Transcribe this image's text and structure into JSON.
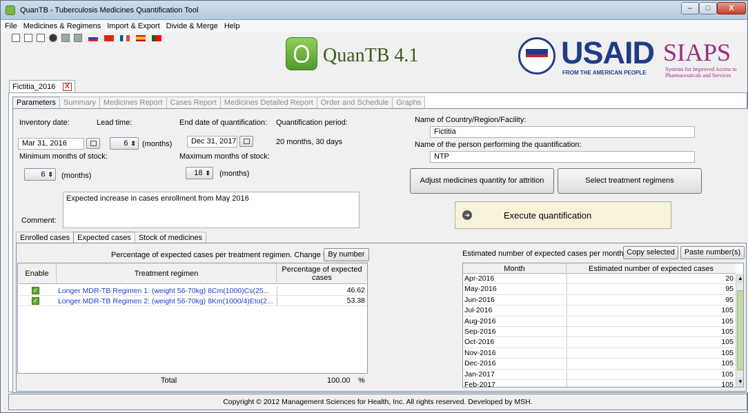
{
  "window": {
    "title": "QuanTB - Tuberculosis Medicines Quantification Tool",
    "min": "–",
    "max": "□",
    "close": "X"
  },
  "menu": [
    "File",
    "Medicines & Regimens",
    "Import & Export",
    "Divide & Merge",
    "Help"
  ],
  "brand": {
    "name": "QuanTB 4.1",
    "usaid": "USAID",
    "usaid_tag": "FROM THE AMERICAN PEOPLE",
    "siaps": "SIAPS",
    "siaps_tag": "Systems for Improved Access to Pharmaceuticals and Services"
  },
  "doc_tab": {
    "label": "Fictitia_2016",
    "close": "X"
  },
  "page_tabs": [
    "Parameters",
    "Summary",
    "Medicines Report",
    "Cases Report",
    "Medicines Detailed Report",
    "Order and Schedule",
    "Graphs"
  ],
  "params": {
    "inventory_label": "Inventory date:",
    "inventory_value": "Mar 31, 2016",
    "lead_label": "Lead time:",
    "lead_value": "6",
    "lead_unit": "(months)",
    "end_label": "End date of quantification:",
    "end_value": "Dec 31, 2017",
    "period_label": "Quantification period:",
    "period_value": "20 months, 30 days",
    "min_label": "Minimum months of stock:",
    "min_value": "6",
    "min_unit": "(months)",
    "max_label": "Maximum months of stock:",
    "max_value": "18",
    "max_unit": "(months)",
    "comment_label": "Comment:",
    "comment_value": "Expected increase in cases enrollment from May 2016",
    "country_label": "Name of Country/Region/Facility:",
    "country_value": "Fictitia",
    "person_label": "Name of the person performing the quantification:",
    "person_value": "NTP",
    "adjust_btn": "Adjust medicines quantity for attrition",
    "select_btn": "Select treatment regimens",
    "execute_btn": "Execute quantification"
  },
  "sub_tabs": [
    "Enrolled cases",
    "Expected cases",
    "Stock of medicines"
  ],
  "regimens": {
    "caption": "Percentage of expected cases per treatment regimen. Change to:",
    "change_btn": "By number",
    "headers": {
      "enable": "Enable",
      "regimen": "Treatment regimen",
      "pct": "Percentage of expected cases"
    },
    "rows": [
      {
        "name": "Longer MDR-TB Regimen 1: (weight 56-70kg)  8Cm(1000)Cs(25...",
        "pct": "46.62"
      },
      {
        "name": "Longer MDR-TB Regimen 2: (weight 56-70kg)  8Km(1000/4)Eto(2...",
        "pct": "53.38"
      }
    ],
    "total_label": "Total",
    "total_value": "100.00",
    "total_unit": "%"
  },
  "monthly": {
    "caption": "Estimated number of expected cases per month",
    "copy_btn": "Copy selected",
    "paste_btn": "Paste number(s)",
    "headers": {
      "month": "Month",
      "cases": "Estimated number of expected cases"
    },
    "rows": [
      {
        "month": "Apr-2016",
        "value": "20"
      },
      {
        "month": "May-2016",
        "value": "95"
      },
      {
        "month": "Jun-2016",
        "value": "95"
      },
      {
        "month": "Jul-2016",
        "value": "105"
      },
      {
        "month": "Aug-2016",
        "value": "105"
      },
      {
        "month": "Sep-2016",
        "value": "105"
      },
      {
        "month": "Oct-2016",
        "value": "105"
      },
      {
        "month": "Nov-2016",
        "value": "105"
      },
      {
        "month": "Dec-2016",
        "value": "105"
      },
      {
        "month": "Jan-2017",
        "value": "105"
      },
      {
        "month": "Feb-2017",
        "value": "105"
      }
    ]
  },
  "footer": "Copyright © 2012 Management Sciences for Health, Inc. All rights reserved. Developed by MSH."
}
